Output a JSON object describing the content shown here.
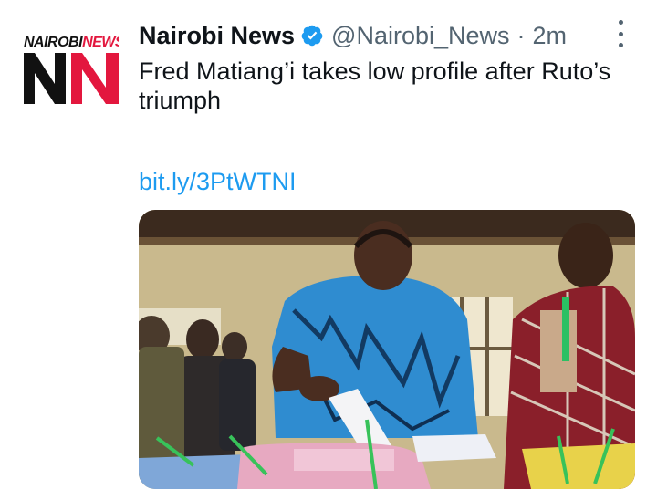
{
  "tweet": {
    "avatar": {
      "brand_left": "NAIROBI",
      "brand_right": "NEWS",
      "monogram": "NN"
    },
    "author_name": "Nairobi News",
    "verified_icon": "verified-badge-icon",
    "handle": "@Nairobi_News",
    "separator": "·",
    "timestamp": "2m",
    "text": "Fred Matiang’i takes low profile after Ruto’s triumph",
    "link": "bit.ly/3PtWTNI",
    "more_icon": "more-vertical-icon"
  },
  "colors": {
    "link": "#1d9bf0",
    "secondary_text": "#536471",
    "brand_red": "#e3173e"
  }
}
